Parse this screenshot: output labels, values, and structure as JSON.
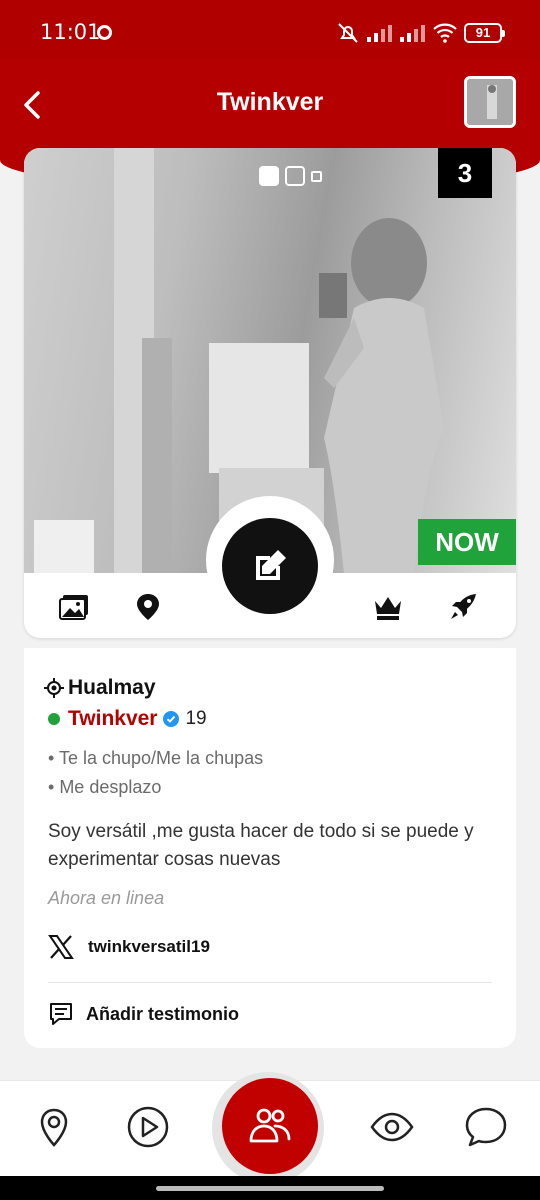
{
  "status_bar": {
    "time": "11:01",
    "battery": "91"
  },
  "header": {
    "title": "Twinkver"
  },
  "photo": {
    "count": "3",
    "now_badge": "NOW",
    "pager": {
      "total": 3,
      "active": 1
    }
  },
  "profile": {
    "location": "Hualmay",
    "username": "Twinkver",
    "age": "19",
    "online": true,
    "tags": [
      "Te la chupo/Me la chupas",
      "Me desplazo"
    ],
    "bio": "Soy versátil ,me gusta hacer de todo si se puede y experimentar cosas nuevas",
    "status": "Ahora en linea",
    "twitter_handle": "twinkversatil19",
    "add_testimonial_label": "Añadir testimonio"
  },
  "colors": {
    "brand": "#b50000",
    "online": "#1fa33a",
    "now": "#1fa33a"
  },
  "icons": {
    "card_toolbar": [
      "gallery-icon",
      "map-pin-icon",
      "edit-icon",
      "crown-icon",
      "rocket-icon"
    ],
    "bottom_nav": [
      "location-icon",
      "play-icon",
      "people-icon",
      "eye-icon",
      "chat-icon"
    ]
  }
}
